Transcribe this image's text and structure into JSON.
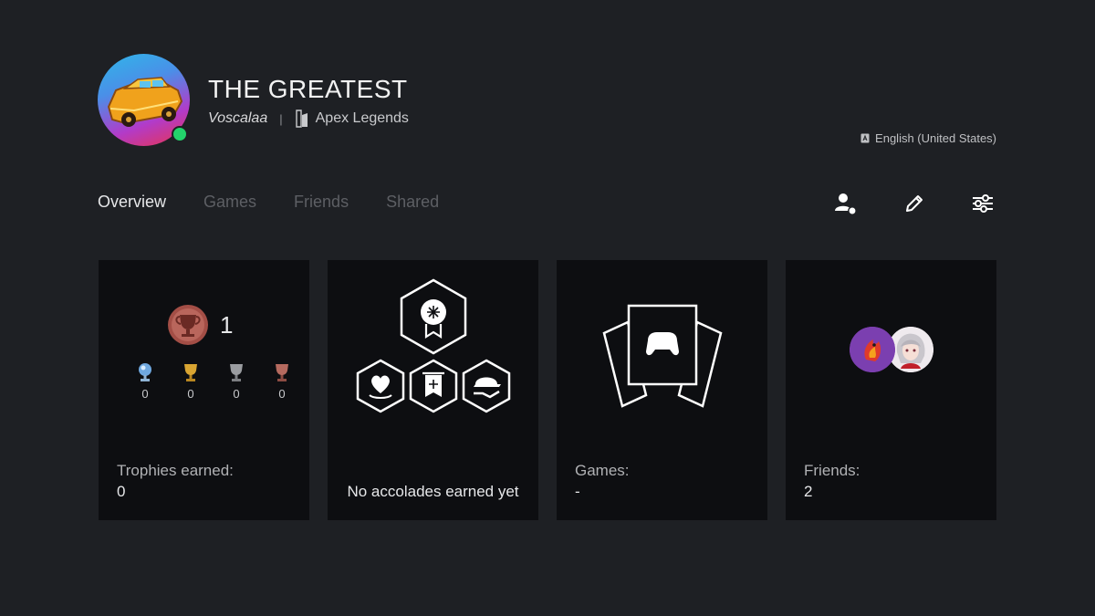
{
  "profile": {
    "name": "THE GREATEST",
    "online_id": "Voscalaa",
    "separator": "|",
    "current_game": "Apex Legends",
    "language": "English (United States)",
    "status": "online"
  },
  "tabs": [
    {
      "label": "Overview",
      "active": true
    },
    {
      "label": "Games",
      "active": false
    },
    {
      "label": "Friends",
      "active": false
    },
    {
      "label": "Shared",
      "active": false
    }
  ],
  "actions": [
    {
      "icon": "add-friend-icon"
    },
    {
      "icon": "pencil-icon"
    },
    {
      "icon": "settings-sliders-icon"
    }
  ],
  "cards": {
    "trophies": {
      "level": "1",
      "platinum": "0",
      "gold": "0",
      "silver": "0",
      "bronze": "0",
      "label": "Trophies earned:",
      "value": "0"
    },
    "accolades": {
      "text": "No accolades earned yet"
    },
    "games": {
      "label": "Games:",
      "value": "-"
    },
    "friends": {
      "label": "Friends:",
      "value": "2"
    }
  },
  "colors": {
    "background": "#1e2024",
    "card": "#0d0e11",
    "online": "#23d36b",
    "tab_inactive": "#5d5f64"
  }
}
